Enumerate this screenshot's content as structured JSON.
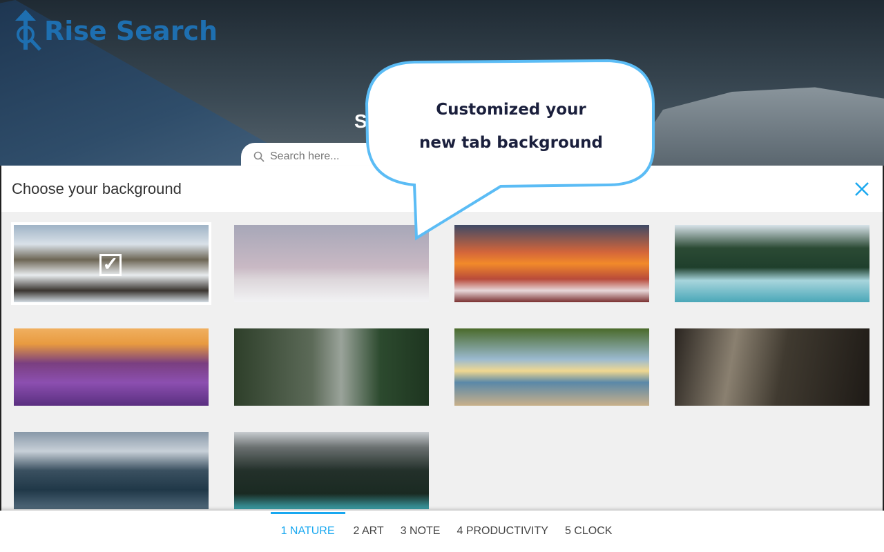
{
  "brand": {
    "name": "Rise Search",
    "color": "#1e6fb0"
  },
  "hero": {
    "heading_fragment": "S"
  },
  "search": {
    "placeholder": "Search here..."
  },
  "panel": {
    "title": "Choose your background",
    "close_icon": "close-icon",
    "accent": "#19a8f0"
  },
  "backgrounds": [
    {
      "name": "snowy-valley-road",
      "selected": true
    },
    {
      "name": "winter-pink-sky",
      "selected": false
    },
    {
      "name": "winter-sunset-village",
      "selected": false
    },
    {
      "name": "misty-forest-lake",
      "selected": false
    },
    {
      "name": "lavender-field-sunset",
      "selected": false
    },
    {
      "name": "forest-river",
      "selected": false
    },
    {
      "name": "tree-sunset-sea",
      "selected": false
    },
    {
      "name": "forest-sunbeams",
      "selected": false
    },
    {
      "name": "fjord-light-beam",
      "selected": false
    },
    {
      "name": "mountain-turquoise-lake",
      "selected": false
    }
  ],
  "tabs": [
    {
      "label": "1 NATURE",
      "active": true
    },
    {
      "label": "2 ART"
    },
    {
      "label": "3 NOTE"
    },
    {
      "label": "4 PRODUCTIVITY"
    },
    {
      "label": "5 CLOCK"
    }
  ],
  "callout": {
    "line1": "Customized your",
    "line2": "new tab background",
    "border_color": "#5bbcf5"
  }
}
